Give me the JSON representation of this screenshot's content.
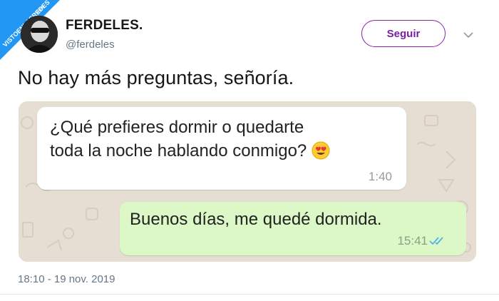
{
  "watermark": {
    "text": "VISTOENLASREDES",
    "subtext": ".com"
  },
  "author": {
    "name": "FERDELES.",
    "handle": "@ferdeles"
  },
  "follow_button": {
    "label": "Seguir",
    "color": "#8e24aa"
  },
  "tweet": {
    "text": "No hay más preguntas, señoría.",
    "timestamp": "18:10 - 19 nov. 2019"
  },
  "chat": {
    "incoming": {
      "line1": "¿Qué prefieres dormir o quedarte",
      "line2": "toda la noche hablando conmigo?",
      "emoji": "heart-eyes-emoji",
      "time": "1:40",
      "bubble_color": "#ffffff"
    },
    "outgoing": {
      "text": "Buenos días, me quedé dormida.",
      "time": "15:41",
      "status": "read-double-check-icon",
      "bubble_color": "#dcf8c6"
    },
    "background_color": "#e6ddd3"
  }
}
